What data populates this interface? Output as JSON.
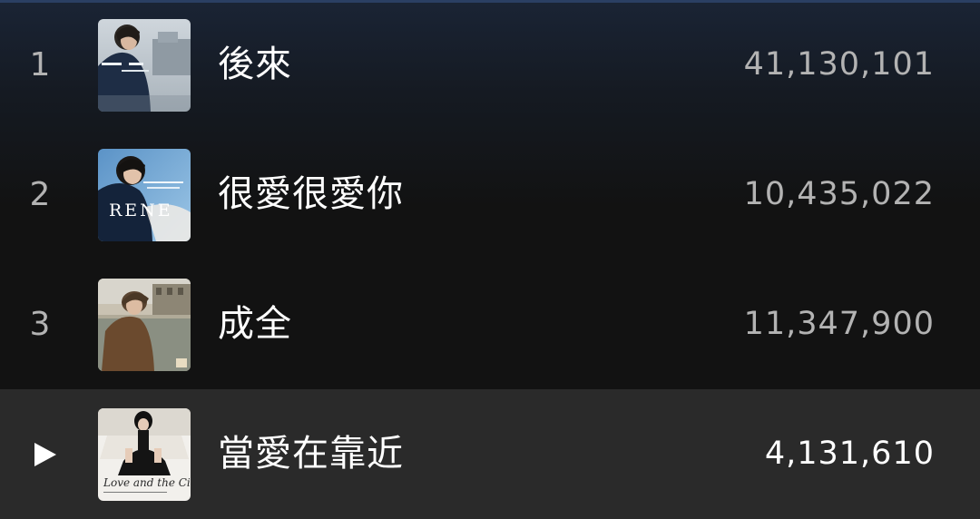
{
  "tracks": [
    {
      "index": "1",
      "title": "後來",
      "plays": "41,130,101",
      "cover_icon": "album-cover-1",
      "active": false
    },
    {
      "index": "2",
      "title": "很愛很愛你",
      "plays": "10,435,022",
      "cover_icon": "album-cover-2",
      "cover_text": "RENE",
      "active": false
    },
    {
      "index": "3",
      "title": "成全",
      "plays": "11,347,900",
      "cover_icon": "album-cover-3",
      "active": false
    },
    {
      "index": "",
      "title": "當愛在靠近",
      "plays": "4,131,610",
      "cover_icon": "album-cover-4",
      "cover_text": "Love and the City",
      "active": true,
      "state_icon": "play-icon"
    }
  ],
  "colors": {
    "background": "#121212",
    "active_row": "#2a2a2a",
    "text_primary": "#ffffff",
    "text_secondary": "#b3b3b3"
  }
}
